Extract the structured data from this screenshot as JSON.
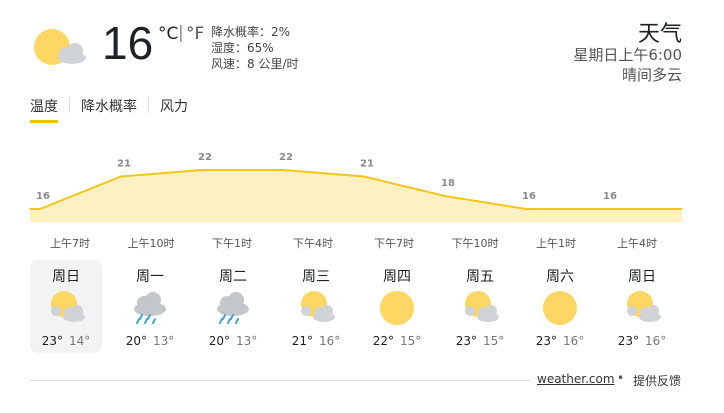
{
  "current": {
    "temperature": "16",
    "unit_c": "°C",
    "unit_sep": "|",
    "unit_f": "°F",
    "precip": "降水概率：2%",
    "humidity": "湿度：65%",
    "wind": "风速：8 公里/时",
    "icon": "partly-cloudy-icon"
  },
  "header": {
    "title": "天气",
    "time": "星期日上午6:00",
    "condition": "晴间多云"
  },
  "tabs": [
    {
      "label": "温度",
      "selected": true
    },
    {
      "label": "降水概率",
      "selected": false
    },
    {
      "label": "风力",
      "selected": false
    }
  ],
  "colors": {
    "accent": "#fbbc04",
    "chart_line": "#f5c518",
    "chart_fill": "#fdf1c4",
    "sun": "#fdd663",
    "cloud": "#d0d3d6",
    "rain": "#3fa7d6"
  },
  "chart_data": {
    "type": "area",
    "title": "",
    "xlabel": "",
    "ylabel": "",
    "x": [
      "上午7时",
      "上午10时",
      "下午1时",
      "下午4时",
      "下午7时",
      "下午10时",
      "上午1时",
      "上午4时"
    ],
    "values": [
      16,
      21,
      22,
      22,
      21,
      18,
      16,
      16
    ],
    "labels": [
      "16",
      "21",
      "22",
      "22",
      "21",
      "18",
      "16",
      "16"
    ],
    "grid": false
  },
  "days": [
    {
      "name": "周日",
      "icon": "partly-cloudy-icon",
      "hi": "23°",
      "lo": "14°",
      "selected": true
    },
    {
      "name": "周一",
      "icon": "rain-cloud-icon",
      "hi": "20°",
      "lo": "13°",
      "selected": false
    },
    {
      "name": "周二",
      "icon": "rain-cloud-icon",
      "hi": "20°",
      "lo": "13°",
      "selected": false
    },
    {
      "name": "周三",
      "icon": "partly-cloudy-icon",
      "hi": "21°",
      "lo": "16°",
      "selected": false
    },
    {
      "name": "周四",
      "icon": "sun-icon",
      "hi": "22°",
      "lo": "15°",
      "selected": false
    },
    {
      "name": "周五",
      "icon": "partly-cloudy-icon",
      "hi": "23°",
      "lo": "15°",
      "selected": false
    },
    {
      "name": "周六",
      "icon": "sun-icon",
      "hi": "23°",
      "lo": "16°",
      "selected": false
    },
    {
      "name": "周日",
      "icon": "partly-cloudy-icon",
      "hi": "23°",
      "lo": "16°",
      "selected": false
    }
  ],
  "footer": {
    "source": "weather.com",
    "separator": "•",
    "feedback": "提供反馈"
  }
}
